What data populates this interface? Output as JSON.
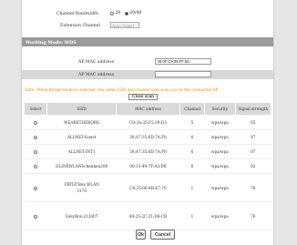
{
  "channel_bandwidth": {
    "label": "Channel Bandwidth",
    "options": [
      {
        "label": "20",
        "selected": false
      },
      {
        "label": "20/40",
        "selected": true
      }
    ]
  },
  "extension_channel": {
    "label": "Extension Channel",
    "value": "Auto Select"
  },
  "section": {
    "title": "Working Mode: WDS"
  },
  "ap_mac_1": {
    "label": "AP MAC address",
    "value": "00:0F:C9:09:FF:56"
  },
  "ap_mac_2": {
    "label": "AP MAC address",
    "value": ""
  },
  "note": "Note: When Bridge mode is selected, the same SSID and channel will scan out on the connected AP.",
  "scan_button": "Close scan",
  "table": {
    "headers": [
      "Select",
      "SSID",
      "MAC address",
      "Channel",
      "Security",
      "Signal strength"
    ],
    "rows": [
      {
        "ssid": [
          "WEARETHEBORG"
        ],
        "mac": "C8:3A:35:F2:39:D3",
        "channel": "5",
        "security": "wpa/wpa",
        "signal": "85"
      },
      {
        "ssid": [
          "ALLNET-Guest"
        ],
        "mac": "30:A7:35:6D:7A:F8",
        "channel": "6",
        "security": "wpa/wpa",
        "signal": "87"
      },
      {
        "ssid": [
          "ALLNET-INT1"
        ],
        "mac": "30:A7:35:6D:7A:F8",
        "channel": "6",
        "security": "wpa/wpa",
        "signal": "87"
      },
      {
        "ssid": [
          "DLINKWLANSchenken206"
        ],
        "mac": "00:13:49:7F:A3:D8",
        "channel": "6",
        "security": "wpa/wpa",
        "signal": "82"
      },
      {
        "ssid": [
          "FRITZ!Box WLAN",
          "3170"
        ],
        "mac": "C0:25:06:4B:E7:70",
        "channel": "1",
        "security": "wpa/wpa",
        "signal": "78"
      },
      {
        "ssid": [
          "EasyBox-212607"
        ],
        "mac": "88:25:2C:21:D8:CB",
        "channel": "1",
        "security": "wpa/wpa",
        "signal": "76"
      }
    ]
  },
  "buttons": {
    "ok": "Ok",
    "cancel": "Cancel"
  },
  "colors": {
    "section_bar": "#9a9a9a",
    "note": "#e58a14",
    "page_background": "#e6e6e6"
  }
}
